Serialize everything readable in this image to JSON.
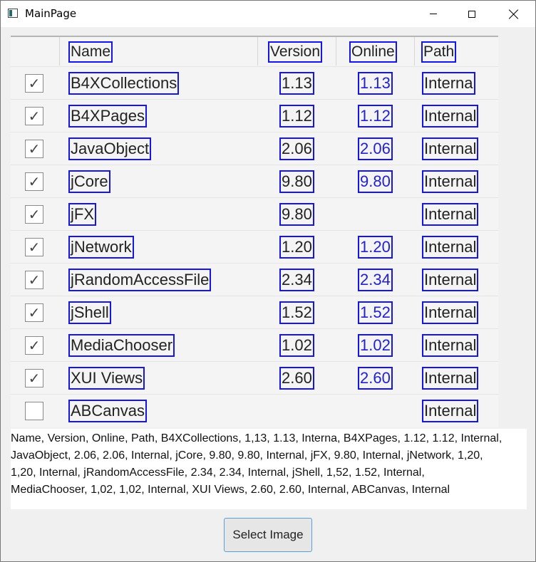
{
  "window": {
    "title": "MainPage"
  },
  "table": {
    "headers": {
      "name": "Name",
      "version": "Version",
      "online": "Online",
      "path": "Path"
    },
    "rows": [
      {
        "checked": true,
        "name": "B4XCollections",
        "version": "1.13",
        "online": "1.13",
        "path": "Interna"
      },
      {
        "checked": true,
        "name": "B4XPages",
        "version": "1.12",
        "online": "1.12",
        "path": "Internal"
      },
      {
        "checked": true,
        "name": "JavaObject",
        "version": "2.06",
        "online": "2.06",
        "path": "Internal"
      },
      {
        "checked": true,
        "name": "jCore",
        "version": "9.80",
        "online": "9.80",
        "path": "Internal"
      },
      {
        "checked": true,
        "name": "jFX",
        "version": "9.80",
        "online": "",
        "path": "Internal"
      },
      {
        "checked": true,
        "name": "jNetwork",
        "version": "1.20",
        "online": "1.20",
        "path": "Internal"
      },
      {
        "checked": true,
        "name": "jRandomAccessFile",
        "version": "2.34",
        "online": "2.34",
        "path": "Internal"
      },
      {
        "checked": true,
        "name": "jShell",
        "version": "1.52",
        "online": "1.52",
        "path": "Internal"
      },
      {
        "checked": true,
        "name": "MediaChooser",
        "version": "1.02",
        "online": "1.02",
        "path": "Internal"
      },
      {
        "checked": true,
        "name": "XUI Views",
        "version": "2.60",
        "online": "2.60",
        "path": "Internal"
      },
      {
        "checked": false,
        "name": "ABCanvas",
        "version": "",
        "online": "",
        "path": "Internal"
      }
    ]
  },
  "summary": {
    "lines": [
      "Name, Version, Online, Path, B4XCollections, 1,13, 1.13, Interna, B4XPages, 1.12, 1.12, Internal,",
      "JavaObject, 2.06, 2.06, Internal, jCore, 9.80, 9.80, Internal, jFX, 9.80, Internal, jNetwork, 1,20,",
      "1,20, Internal, jRandomAccessFile, 2.34, 2.34, Internal, jShell, 1,52, 1.52, Internal,",
      "MediaChooser, 1,02, 1,02, Internal, XUI Views, 2.60, 2.60, Internal, ABCanvas, Internal"
    ]
  },
  "buttons": {
    "select_image": "Select Image"
  },
  "colors": {
    "box_outline": "#1515e8",
    "online_text": "#2222cc",
    "button_border": "#5aa0d8"
  }
}
